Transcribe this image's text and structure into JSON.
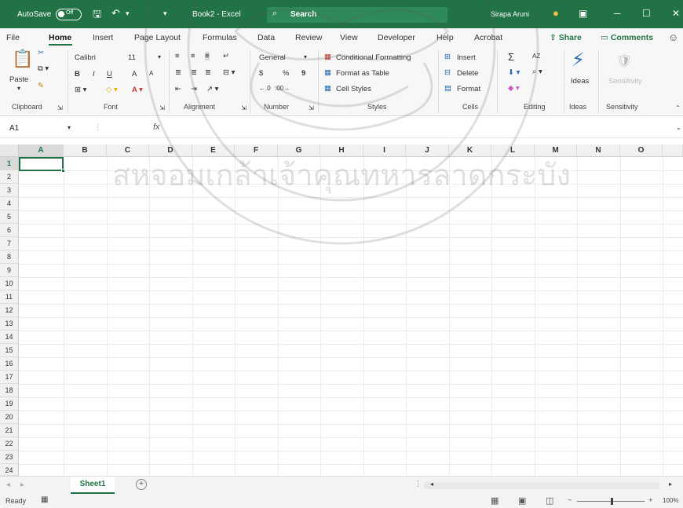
{
  "titlebar": {
    "autosave_label": "AutoSave",
    "autosave_state": "Off",
    "document_title": "Book2 - Excel",
    "search_label": "Search",
    "user_name": "Sirapa Aruni"
  },
  "tabs": [
    "File",
    "Home",
    "Insert",
    "Page Layout",
    "Formulas",
    "Data",
    "Review",
    "View",
    "Developer",
    "Help",
    "Acrobat"
  ],
  "share_label": "Share",
  "comments_label": "Comments",
  "ribbon": {
    "clipboard": {
      "paste": "Paste",
      "group": "Clipboard"
    },
    "font": {
      "name": "Calibri",
      "size": "11",
      "group": "Font",
      "bold": "B",
      "italic": "I",
      "underline": "U",
      "grow": "A",
      "shrink": "A"
    },
    "alignment": {
      "group": "Alignment"
    },
    "number": {
      "format": "General",
      "currency": "$",
      "percent": "%",
      "comma": "9",
      "dec_inc": "←.0",
      "dec_dec": ".00→",
      "group": "Number"
    },
    "styles": {
      "conditional": "Conditional Formatting",
      "table": "Format as Table",
      "cell_styles": "Cell Styles",
      "group": "Styles"
    },
    "cells": {
      "insert": "Insert",
      "delete": "Delete",
      "format": "Format",
      "group": "Cells"
    },
    "editing": {
      "sum": "Σ",
      "sort": "AZ",
      "group": "Editing"
    },
    "ideas": {
      "label": "Ideas",
      "group": "Ideas"
    },
    "sensitivity": {
      "label": "Sensitivity",
      "group": "Sensitivity"
    }
  },
  "formula_bar": {
    "name_box": "A1",
    "fx": "fx",
    "value": ""
  },
  "grid": {
    "columns": [
      "A",
      "B",
      "C",
      "D",
      "E",
      "F",
      "G",
      "H",
      "I",
      "J",
      "K",
      "L",
      "M",
      "N",
      "O"
    ],
    "rows": [
      "1",
      "2",
      "3",
      "4",
      "5",
      "6",
      "7",
      "8",
      "9",
      "10",
      "11",
      "12",
      "13",
      "14",
      "15",
      "16",
      "17",
      "18",
      "19",
      "20",
      "21",
      "22",
      "23",
      "24"
    ],
    "active_cell": "A1"
  },
  "sheets": [
    "Sheet1"
  ],
  "status": {
    "ready": "Ready",
    "zoom": "100%"
  },
  "watermark_text": "สหจอมเกล้าเจ้าคุณทหารลาดกระบัง"
}
